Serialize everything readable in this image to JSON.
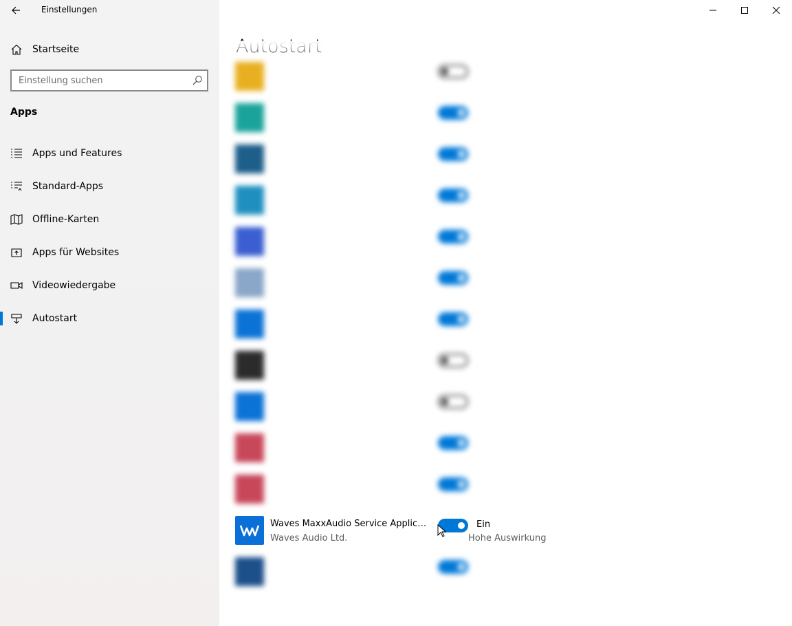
{
  "window": {
    "title": "Einstellungen",
    "controls": [
      "minimize-icon",
      "maximize-icon",
      "close-icon"
    ]
  },
  "sidebar": {
    "home_label": "Startseite",
    "search_placeholder": "Einstellung suchen",
    "section_title": "Apps",
    "items": [
      {
        "label": "Apps und Features",
        "icon": "apps-features-icon",
        "active": false
      },
      {
        "label": "Standard-Apps",
        "icon": "default-apps-icon",
        "active": false
      },
      {
        "label": "Offline-Karten",
        "icon": "map-icon",
        "active": false
      },
      {
        "label": "Apps für Websites",
        "icon": "web-apps-icon",
        "active": false
      },
      {
        "label": "Videowiedergabe",
        "icon": "video-icon",
        "active": false
      },
      {
        "label": "Autostart",
        "icon": "startup-icon",
        "active": true
      }
    ]
  },
  "main": {
    "title": "Autostart",
    "apps": [
      {
        "name": "",
        "publisher": "",
        "state": "",
        "impact": "",
        "enabled": false,
        "blurred": true,
        "icon_color": "#e8b020"
      },
      {
        "name": "",
        "publisher": "",
        "state": "",
        "impact": "",
        "enabled": true,
        "blurred": true,
        "icon_color": "#1aa39a"
      },
      {
        "name": "",
        "publisher": "",
        "state": "",
        "impact": "",
        "enabled": true,
        "blurred": true,
        "icon_color": "#1d5e8a"
      },
      {
        "name": "",
        "publisher": "",
        "state": "",
        "impact": "",
        "enabled": true,
        "blurred": true,
        "icon_color": "#1f8fc0"
      },
      {
        "name": "",
        "publisher": "",
        "state": "",
        "impact": "",
        "enabled": true,
        "blurred": true,
        "icon_color": "#3b5fd1"
      },
      {
        "name": "",
        "publisher": "",
        "state": "",
        "impact": "",
        "enabled": true,
        "blurred": true,
        "icon_color": "#8aa6c8"
      },
      {
        "name": "",
        "publisher": "",
        "state": "",
        "impact": "",
        "enabled": true,
        "blurred": true,
        "icon_color": "#0b72d6"
      },
      {
        "name": "",
        "publisher": "",
        "state": "",
        "impact": "",
        "enabled": false,
        "blurred": true,
        "icon_color": "#2b2b2b"
      },
      {
        "name": "",
        "publisher": "",
        "state": "",
        "impact": "",
        "enabled": false,
        "blurred": true,
        "icon_color": "#0b72d6"
      },
      {
        "name": "",
        "publisher": "",
        "state": "",
        "impact": "",
        "enabled": true,
        "blurred": true,
        "icon_color": "#c8485a"
      },
      {
        "name": "",
        "publisher": "",
        "state": "",
        "impact": "",
        "enabled": true,
        "blurred": true,
        "icon_color": "#c8485a"
      },
      {
        "name": "Waves MaxxAudio Service Applicati...",
        "publisher": "Waves Audio Ltd.",
        "state": "Ein",
        "impact": "Hohe Auswirkung",
        "enabled": true,
        "blurred": false,
        "icon_color": "#0b6fd8"
      },
      {
        "name": "",
        "publisher": "",
        "state": "",
        "impact": "",
        "enabled": true,
        "blurred": true,
        "icon_color": "#1d4f8a"
      }
    ]
  },
  "colors": {
    "accent": "#0078d7",
    "sidebar_bg": "#f2f2f2"
  }
}
